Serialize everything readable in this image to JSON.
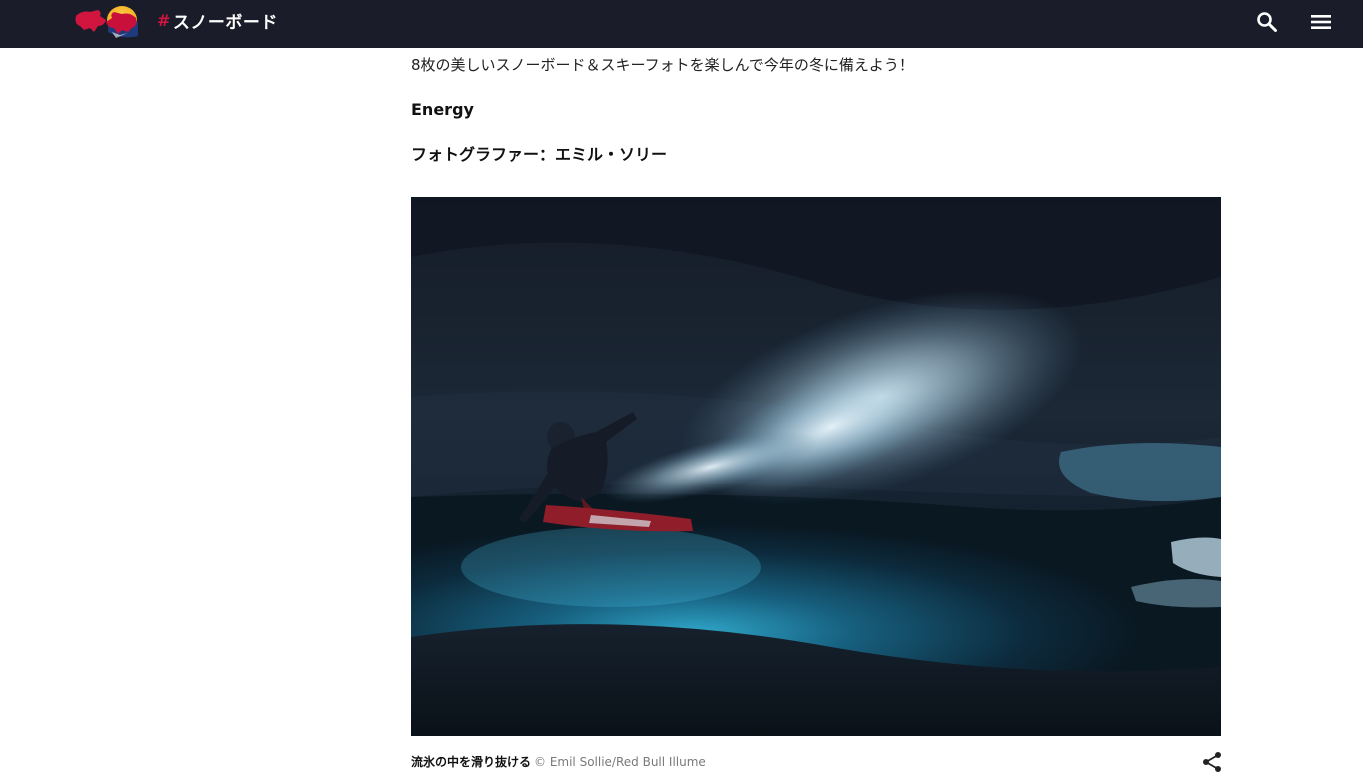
{
  "header": {
    "logo_icon": "red-bull-logo-icon",
    "section_hash": "#",
    "section_label": "スノーボード",
    "search_icon": "search-icon",
    "menu_icon": "hamburger-menu-icon",
    "background_color": "#1a1d29",
    "accent_color": "#d1153f"
  },
  "article": {
    "lead_text": "8枚の美しいスノーボード＆スキーフォトを楽しんで今年の冬に備えよう！",
    "subheading_energy": "Energy",
    "subheading_photographer": "フォトグラファー：エミル・ソリー",
    "photo": {
      "caption_title": "流氷の中を滑り抜ける",
      "caption_credit": "© Emil Sollie/Red Bull Illume",
      "share_icon": "share-icon"
    }
  }
}
